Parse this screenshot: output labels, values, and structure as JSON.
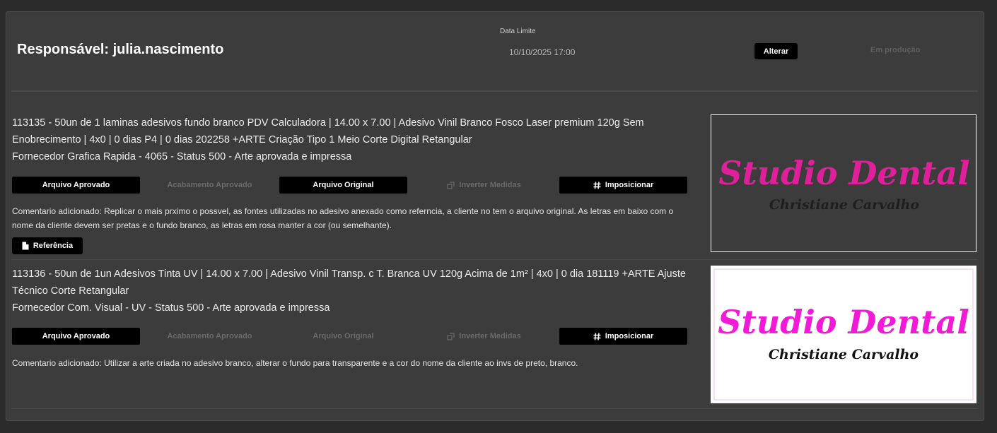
{
  "header": {
    "responsavel": "Responsável: julia.nascimento",
    "date_label": "Data Limite",
    "date_value": "10/10/2025 17:00",
    "alterar_label": "Alterar",
    "status": "Em produção"
  },
  "items": [
    {
      "line1": "113135 - 50un de 1 laminas adesivos fundo branco PDV Calculadora  | 14.00 x 7.00 | Adesivo Vinil Branco Fosco Laser premium 120g Sem Enobrecimento | 4x0 | 0 dias P4 | 0 dias 202258   +ARTE Criação Tipo 1 Meio Corte Digital Retangular",
      "line2": "Fornecedor Grafica Rapida - 4065 - Status 500 -  Arte aprovada e impressa",
      "buttons": {
        "arquivo_aprovado": "Arquivo Aprovado",
        "acabamento_aprovado": "Acabamento Aprovado",
        "arquivo_original": "Arquivo Original",
        "inverter_medidas": "Inverter Medidas",
        "imposicionar": "Imposicionar"
      },
      "comment": "Comentario adicionado: Replicar o mais prximo o possvel, as fontes utilizadas no adesivo anexado como referncia, a cliente no tem o arquivo original. As letras em baixo com o nome da cliente devem ser pretas e o fundo branco, as letras em rosa manter a cor (ou semelhante).",
      "referencia_label": "Referência",
      "preview": {
        "brand": "Studio Dental",
        "name": "Christiane Carvalho",
        "background": "#3c3c3c",
        "brand_color": "#e0209a",
        "name_color": "#1e1e1e"
      }
    },
    {
      "line1": "113136 - 50un de 1un Adesivos Tinta UV  | 14.00 x 7.00 | Adesivo Vinil Transp. c T. Branca UV 120g Acima de 1m² | 4x0 | 0 dia 181119    +ARTE Ajuste Técnico Corte Retangular",
      "line2": "Fornecedor Com. Visual - UV - Status 500 -  Arte aprovada e impressa",
      "buttons": {
        "arquivo_aprovado": "Arquivo Aprovado",
        "acabamento_aprovado": "Acabamento Aprovado",
        "arquivo_original": "Arquivo Original",
        "inverter_medidas": "Inverter Medidas",
        "imposicionar": "Imposicionar"
      },
      "comment": "Comentario adicionado: Utilizar a arte criada no adesivo branco, alterar o fundo para transparente e a cor do nome da cliente ao invs de preto, branco.",
      "preview": {
        "brand": "Studio Dental",
        "name": "Christiane Carvalho",
        "background": "#ffffff",
        "brand_color": "#f21ad6",
        "name_color": "#111111"
      }
    }
  ]
}
